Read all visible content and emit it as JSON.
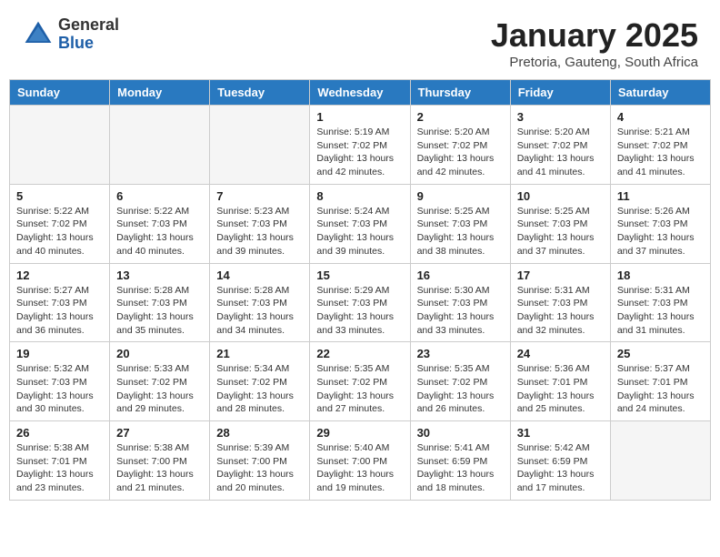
{
  "header": {
    "logo_general": "General",
    "logo_blue": "Blue",
    "month_title": "January 2025",
    "subtitle": "Pretoria, Gauteng, South Africa"
  },
  "days_of_week": [
    "Sunday",
    "Monday",
    "Tuesday",
    "Wednesday",
    "Thursday",
    "Friday",
    "Saturday"
  ],
  "weeks": [
    [
      {
        "day": "",
        "info": ""
      },
      {
        "day": "",
        "info": ""
      },
      {
        "day": "",
        "info": ""
      },
      {
        "day": "1",
        "info": "Sunrise: 5:19 AM\nSunset: 7:02 PM\nDaylight: 13 hours and 42 minutes."
      },
      {
        "day": "2",
        "info": "Sunrise: 5:20 AM\nSunset: 7:02 PM\nDaylight: 13 hours and 42 minutes."
      },
      {
        "day": "3",
        "info": "Sunrise: 5:20 AM\nSunset: 7:02 PM\nDaylight: 13 hours and 41 minutes."
      },
      {
        "day": "4",
        "info": "Sunrise: 5:21 AM\nSunset: 7:02 PM\nDaylight: 13 hours and 41 minutes."
      }
    ],
    [
      {
        "day": "5",
        "info": "Sunrise: 5:22 AM\nSunset: 7:02 PM\nDaylight: 13 hours and 40 minutes."
      },
      {
        "day": "6",
        "info": "Sunrise: 5:22 AM\nSunset: 7:03 PM\nDaylight: 13 hours and 40 minutes."
      },
      {
        "day": "7",
        "info": "Sunrise: 5:23 AM\nSunset: 7:03 PM\nDaylight: 13 hours and 39 minutes."
      },
      {
        "day": "8",
        "info": "Sunrise: 5:24 AM\nSunset: 7:03 PM\nDaylight: 13 hours and 39 minutes."
      },
      {
        "day": "9",
        "info": "Sunrise: 5:25 AM\nSunset: 7:03 PM\nDaylight: 13 hours and 38 minutes."
      },
      {
        "day": "10",
        "info": "Sunrise: 5:25 AM\nSunset: 7:03 PM\nDaylight: 13 hours and 37 minutes."
      },
      {
        "day": "11",
        "info": "Sunrise: 5:26 AM\nSunset: 7:03 PM\nDaylight: 13 hours and 37 minutes."
      }
    ],
    [
      {
        "day": "12",
        "info": "Sunrise: 5:27 AM\nSunset: 7:03 PM\nDaylight: 13 hours and 36 minutes."
      },
      {
        "day": "13",
        "info": "Sunrise: 5:28 AM\nSunset: 7:03 PM\nDaylight: 13 hours and 35 minutes."
      },
      {
        "day": "14",
        "info": "Sunrise: 5:28 AM\nSunset: 7:03 PM\nDaylight: 13 hours and 34 minutes."
      },
      {
        "day": "15",
        "info": "Sunrise: 5:29 AM\nSunset: 7:03 PM\nDaylight: 13 hours and 33 minutes."
      },
      {
        "day": "16",
        "info": "Sunrise: 5:30 AM\nSunset: 7:03 PM\nDaylight: 13 hours and 33 minutes."
      },
      {
        "day": "17",
        "info": "Sunrise: 5:31 AM\nSunset: 7:03 PM\nDaylight: 13 hours and 32 minutes."
      },
      {
        "day": "18",
        "info": "Sunrise: 5:31 AM\nSunset: 7:03 PM\nDaylight: 13 hours and 31 minutes."
      }
    ],
    [
      {
        "day": "19",
        "info": "Sunrise: 5:32 AM\nSunset: 7:03 PM\nDaylight: 13 hours and 30 minutes."
      },
      {
        "day": "20",
        "info": "Sunrise: 5:33 AM\nSunset: 7:02 PM\nDaylight: 13 hours and 29 minutes."
      },
      {
        "day": "21",
        "info": "Sunrise: 5:34 AM\nSunset: 7:02 PM\nDaylight: 13 hours and 28 minutes."
      },
      {
        "day": "22",
        "info": "Sunrise: 5:35 AM\nSunset: 7:02 PM\nDaylight: 13 hours and 27 minutes."
      },
      {
        "day": "23",
        "info": "Sunrise: 5:35 AM\nSunset: 7:02 PM\nDaylight: 13 hours and 26 minutes."
      },
      {
        "day": "24",
        "info": "Sunrise: 5:36 AM\nSunset: 7:01 PM\nDaylight: 13 hours and 25 minutes."
      },
      {
        "day": "25",
        "info": "Sunrise: 5:37 AM\nSunset: 7:01 PM\nDaylight: 13 hours and 24 minutes."
      }
    ],
    [
      {
        "day": "26",
        "info": "Sunrise: 5:38 AM\nSunset: 7:01 PM\nDaylight: 13 hours and 23 minutes."
      },
      {
        "day": "27",
        "info": "Sunrise: 5:38 AM\nSunset: 7:00 PM\nDaylight: 13 hours and 21 minutes."
      },
      {
        "day": "28",
        "info": "Sunrise: 5:39 AM\nSunset: 7:00 PM\nDaylight: 13 hours and 20 minutes."
      },
      {
        "day": "29",
        "info": "Sunrise: 5:40 AM\nSunset: 7:00 PM\nDaylight: 13 hours and 19 minutes."
      },
      {
        "day": "30",
        "info": "Sunrise: 5:41 AM\nSunset: 6:59 PM\nDaylight: 13 hours and 18 minutes."
      },
      {
        "day": "31",
        "info": "Sunrise: 5:42 AM\nSunset: 6:59 PM\nDaylight: 13 hours and 17 minutes."
      },
      {
        "day": "",
        "info": ""
      }
    ]
  ]
}
